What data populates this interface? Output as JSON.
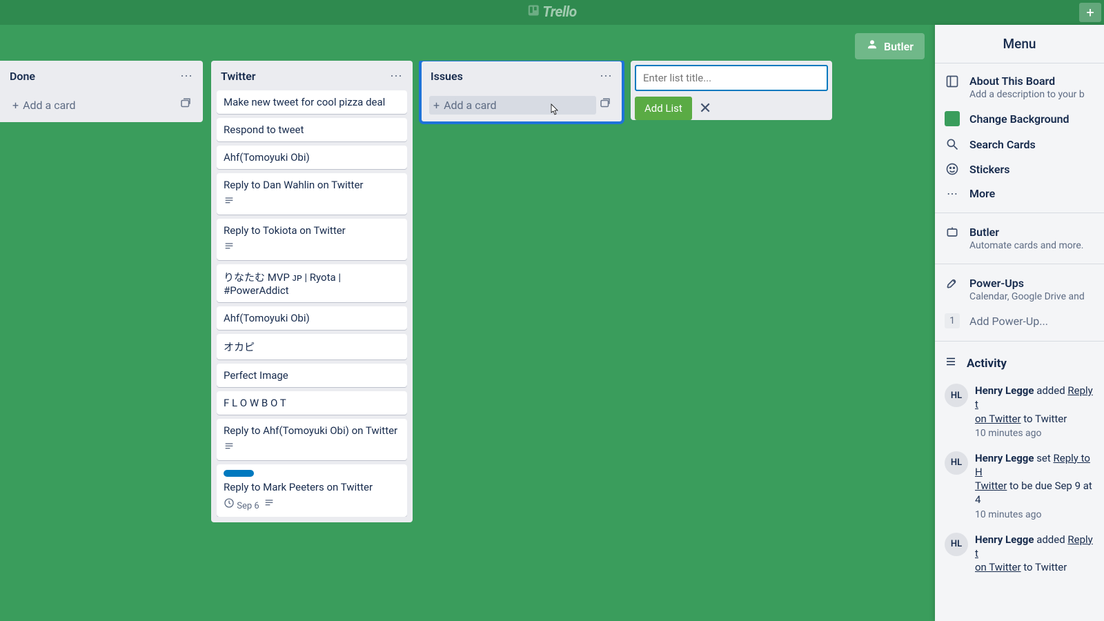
{
  "app": {
    "name": "Trello"
  },
  "topbar": {
    "add_tooltip": "+"
  },
  "butler_button": "Butler",
  "lists": [
    {
      "id": "done",
      "title": "Done",
      "add_card_label": "Add a card",
      "cards": []
    },
    {
      "id": "twitter",
      "title": "Twitter",
      "add_card_label": "Add a card",
      "cards": [
        {
          "text": "Make new tweet for cool pizza deal"
        },
        {
          "text": "Respond to tweet"
        },
        {
          "text": "Ahf(Tomoyuki Obi)"
        },
        {
          "text": "Reply to Dan Wahlin on Twitter",
          "has_desc": true
        },
        {
          "text": "Reply to Tokiota on Twitter",
          "has_desc": true
        },
        {
          "text": "りなたむ MVP ᴊᴘ | Ryota | #PowerAddict"
        },
        {
          "text": "Ahf(Tomoyuki Obi)"
        },
        {
          "text": "オカピ"
        },
        {
          "text": "Perfect Image"
        },
        {
          "text": "F L O W B O T"
        },
        {
          "text": "Reply to Ahf(Tomoyuki Obi) on Twitter",
          "has_desc": true
        },
        {
          "text": "Reply to Mark Peeters on Twitter",
          "label_color": "#0079bf",
          "due": "Sep 6",
          "has_desc": true
        }
      ]
    },
    {
      "id": "issues",
      "title": "Issues",
      "add_card_label": "Add a card",
      "highlighted": true,
      "cards": []
    }
  ],
  "add_list": {
    "placeholder": "Enter list title...",
    "button": "Add List"
  },
  "menu": {
    "title": "Menu",
    "about": {
      "title": "About This Board",
      "sub": "Add a description to your b"
    },
    "change_bg": "Change Background",
    "search_cards": "Search Cards",
    "stickers": "Stickers",
    "more": "More",
    "butler": {
      "title": "Butler",
      "sub": "Automate cards and more."
    },
    "powerups": {
      "title": "Power-Ups",
      "sub": "Calendar, Google Drive and"
    },
    "add_powerup": {
      "count": "1",
      "label": "Add Power-Up..."
    },
    "activity_title": "Activity",
    "activity": [
      {
        "initials": "HL",
        "actor": "Henry Legge",
        "verb": "added",
        "link": "Reply t",
        "tail": "on Twitter",
        "tail2": " to Twitter",
        "time": "10 minutes ago"
      },
      {
        "initials": "HL",
        "actor": "Henry Legge",
        "verb": "set",
        "link": "Reply to H",
        "tail": "Twitter",
        "tail2": " to be due Sep 9 at 4",
        "time": "10 minutes ago"
      },
      {
        "initials": "HL",
        "actor": "Henry Legge",
        "verb": "added",
        "link": "Reply t",
        "tail": "on Twitter",
        "tail2": " to Twitter",
        "time": ""
      }
    ]
  }
}
